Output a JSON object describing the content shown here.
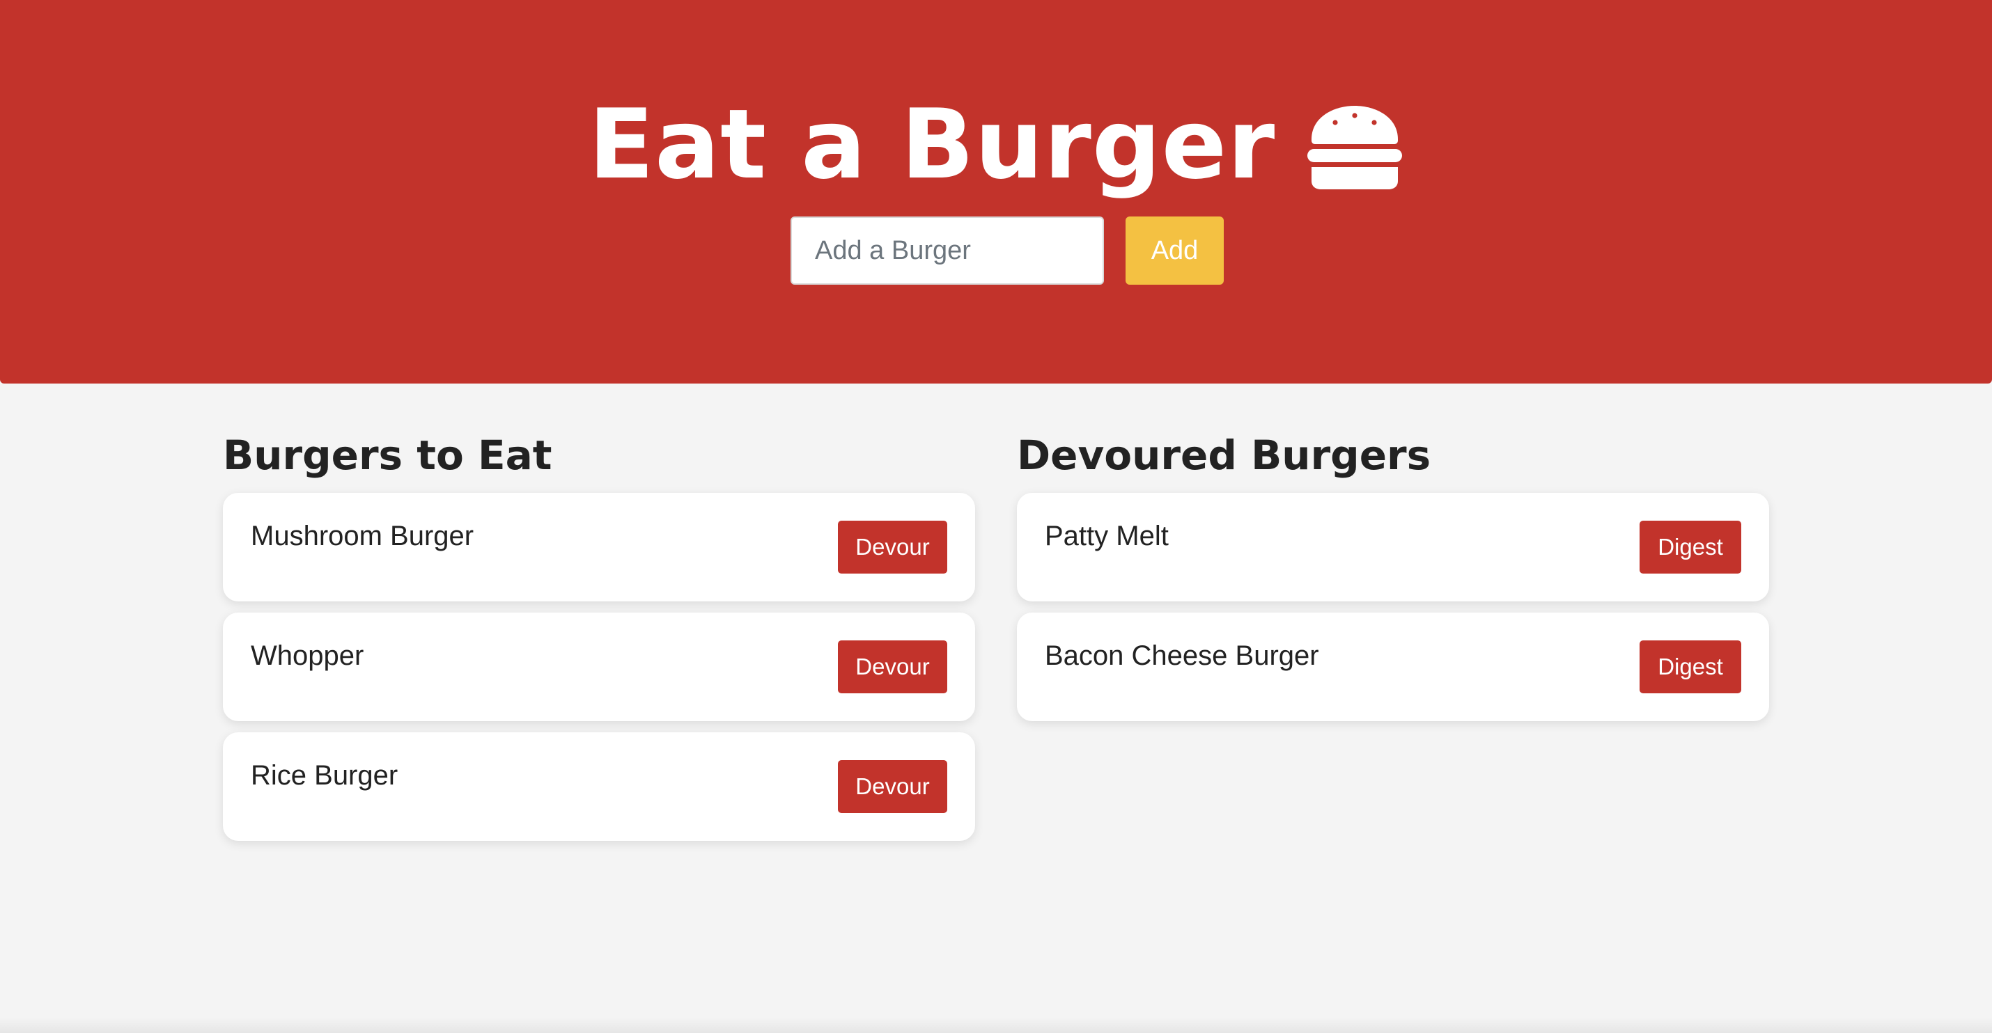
{
  "header": {
    "title": "Eat a Burger",
    "icon": "hamburger-icon",
    "background_color": "#c2332b"
  },
  "add_form": {
    "input_placeholder": "Add a Burger",
    "input_value": "",
    "add_button_label": "Add",
    "add_button_color": "#f4c142"
  },
  "to_eat": {
    "heading": "Burgers to Eat",
    "items": [
      {
        "name": "Mushroom Burger",
        "button_label": "Devour"
      },
      {
        "name": "Whopper",
        "button_label": "Devour"
      },
      {
        "name": "Rice Burger",
        "button_label": "Devour"
      }
    ]
  },
  "devoured": {
    "heading": "Devoured Burgers",
    "items": [
      {
        "name": "Patty Melt",
        "button_label": "Digest"
      },
      {
        "name": "Bacon Cheese Burger",
        "button_label": "Digest"
      }
    ]
  }
}
